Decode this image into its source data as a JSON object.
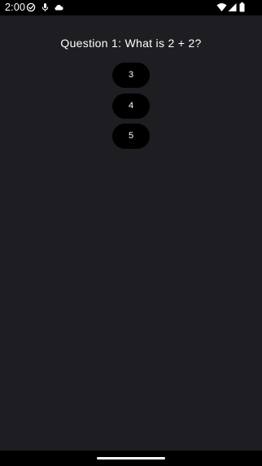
{
  "status_bar": {
    "time": "2:00",
    "left_icons": [
      "check-circle-icon",
      "mic-icon",
      "cloud-icon"
    ],
    "right_icons": [
      "wifi-icon",
      "signal-icon",
      "battery-icon"
    ]
  },
  "quiz": {
    "question": "Question 1: What is 2 + 2?",
    "answers": [
      "3",
      "4",
      "5"
    ]
  },
  "colors": {
    "background": "#1e1d22",
    "button": "#000000",
    "text": "#ffffff",
    "system_bars": "#000000"
  }
}
